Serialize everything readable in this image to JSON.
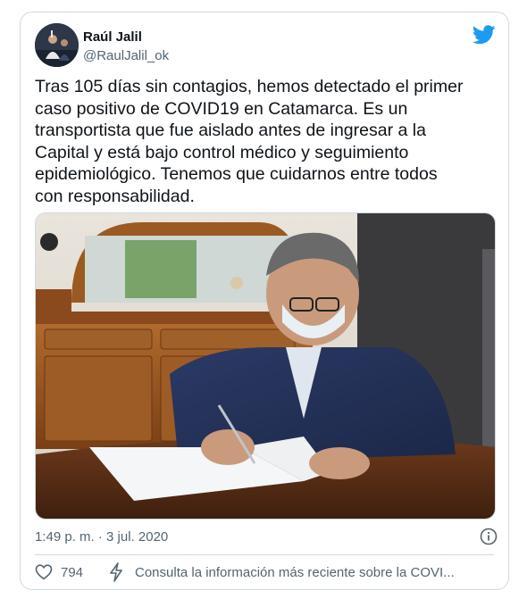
{
  "tweet": {
    "author_name": "Raúl Jalil",
    "author_handle": "@RaulJalil_ok",
    "text": "Tras 105 días sin contagios, hemos detectado el primer\ncaso positivo de COVID19 en Catamarca. Es un\ntransportista que fue aislado antes de ingresar a la\nCapital y está bajo control médico y seguimiento\nepidemiológico. Tenemos que cuidarnos entre todos\ncon responsabilidad.",
    "timestamp": "1:49 p. m. · 3 jul. 2020",
    "likes": "794",
    "info_link": "Consulta la información más reciente sobre la COVI..."
  },
  "icons": {
    "brand": "twitter-bird-icon",
    "info": "info-icon",
    "like": "heart-icon",
    "info_bolt": "lightning-icon"
  },
  "colors": {
    "brand_blue": "#1d9bf0",
    "text_primary": "#0f1419",
    "text_secondary": "#536471",
    "border": "#cfd9de"
  }
}
